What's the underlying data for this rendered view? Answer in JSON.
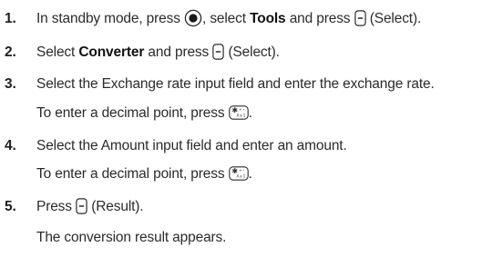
{
  "steps": [
    {
      "num": "1.",
      "parts": {
        "a": "In standby mode, press",
        "b": ", select",
        "c": "Tools",
        "d": "and press",
        "e": "(Select)."
      }
    },
    {
      "num": "2.",
      "parts": {
        "a": "Select",
        "b": "Converter",
        "c": "and press",
        "d": "(Select)."
      }
    },
    {
      "num": "3.",
      "text": "Select the Exchange rate input field and enter the exchange rate.",
      "note_a": "To enter a decimal point, press",
      "note_b": "."
    },
    {
      "num": "4.",
      "text": "Select the Amount input field and enter an amount.",
      "note_a": "To enter a decimal point, press",
      "note_b": "."
    },
    {
      "num": "5.",
      "parts": {
        "a": "Press",
        "b": "(Result)."
      },
      "note": "The conversion result appears."
    }
  ],
  "icons": {
    "nav_key": "nav-center-key-icon",
    "soft_key": "soft-key-icon",
    "star_key": "star-key-icon"
  }
}
